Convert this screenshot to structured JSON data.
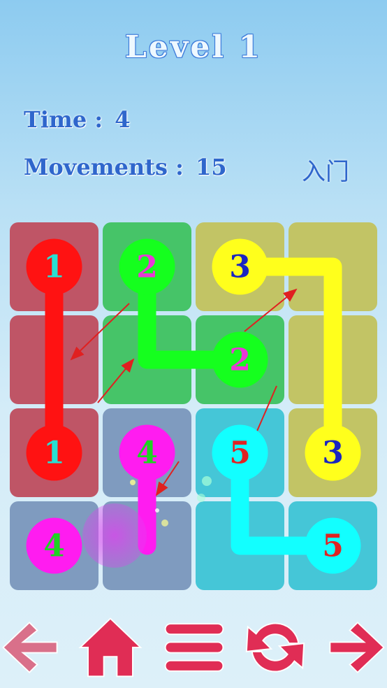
{
  "header": {
    "level_title": "Level 1",
    "time_label": "Time :",
    "time_value": "4",
    "movements_label": "Movements :",
    "movements_value": "15",
    "rank": "入门"
  },
  "board": {
    "rows": 4,
    "cols": 4,
    "cell_groups": [
      [
        1,
        2,
        3,
        3
      ],
      [
        1,
        2,
        2,
        3
      ],
      [
        1,
        4,
        5,
        3
      ],
      [
        4,
        4,
        5,
        5
      ]
    ],
    "colors": {
      "1": {
        "cell": "#bf5566",
        "dot": "#ff1212",
        "text": "#27e0d3"
      },
      "2": {
        "cell": "#46c468",
        "dot": "#15ff1e",
        "text": "#e838d6"
      },
      "3": {
        "cell": "#c2c465",
        "dot": "#ffff1c",
        "text": "#1a25c0"
      },
      "4": {
        "cell": "#7f9bbf",
        "dot": "#ff1cf0",
        "text": "#1fd323"
      },
      "5": {
        "cell": "#45c6d7",
        "dot": "#12ffff",
        "text": "#e02323"
      }
    },
    "endpoints": [
      {
        "row": 0,
        "col": 0,
        "number": "1",
        "group": 1
      },
      {
        "row": 2,
        "col": 0,
        "number": "1",
        "group": 1
      },
      {
        "row": 0,
        "col": 1,
        "number": "2",
        "group": 2
      },
      {
        "row": 1,
        "col": 2,
        "number": "2",
        "group": 2
      },
      {
        "row": 0,
        "col": 2,
        "number": "3",
        "group": 3
      },
      {
        "row": 2,
        "col": 3,
        "number": "3",
        "group": 3
      },
      {
        "row": 2,
        "col": 1,
        "number": "4",
        "group": 4
      },
      {
        "row": 3,
        "col": 0,
        "number": "4",
        "group": 4
      },
      {
        "row": 2,
        "col": 2,
        "number": "5",
        "group": 5
      },
      {
        "row": 3,
        "col": 3,
        "number": "5",
        "group": 5
      }
    ],
    "paths": [
      {
        "group": 1,
        "cells": [
          [
            0,
            0
          ],
          [
            1,
            0
          ],
          [
            2,
            0
          ]
        ]
      },
      {
        "group": 2,
        "cells": [
          [
            0,
            1
          ],
          [
            1,
            1
          ],
          [
            1,
            2
          ]
        ]
      },
      {
        "group": 3,
        "cells": [
          [
            0,
            2
          ],
          [
            0,
            3
          ],
          [
            1,
            3
          ],
          [
            2,
            3
          ]
        ]
      },
      {
        "group": 4,
        "cells": [
          [
            2,
            1
          ],
          [
            3,
            1
          ]
        ]
      },
      {
        "group": 5,
        "cells": [
          [
            2,
            2
          ],
          [
            3,
            2
          ],
          [
            3,
            3
          ]
        ]
      }
    ],
    "hint_arrow_color": "#e02020"
  },
  "toolbar": {
    "buttons": [
      {
        "name": "back-button",
        "icon": "arrow-left-icon",
        "color": "#d9708a"
      },
      {
        "name": "home-button",
        "icon": "home-icon",
        "color": "#e02d55"
      },
      {
        "name": "menu-button",
        "icon": "menu-icon",
        "color": "#e02d55"
      },
      {
        "name": "restart-button",
        "icon": "refresh-icon",
        "color": "#e02d55"
      },
      {
        "name": "next-button",
        "icon": "arrow-right-icon",
        "color": "#e02d55"
      }
    ]
  }
}
